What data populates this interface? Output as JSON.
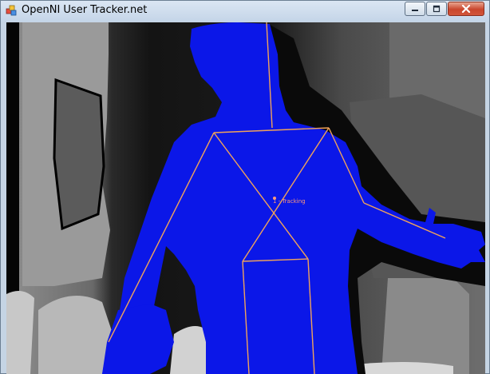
{
  "window": {
    "title": "OpenNI User Tracker.net",
    "icon": "app-window-icon",
    "controls": {
      "minimize": "minimize-icon",
      "maximize": "maximize-icon",
      "close": "close-icon"
    }
  },
  "viewer": {
    "user_label": "1 - Tracking",
    "colors": {
      "user": "#0b17e8",
      "skeleton": "#f0a35a",
      "label": "#ff9a7a",
      "background": "#000000"
    }
  }
}
